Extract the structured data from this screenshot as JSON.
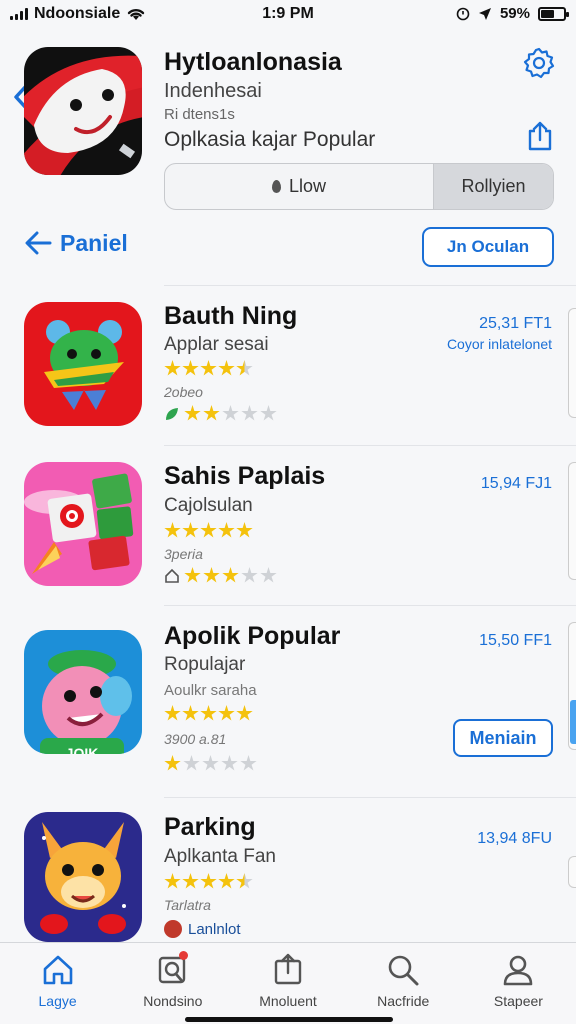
{
  "status_bar": {
    "carrier": "Ndoonsiale",
    "time": "1:9 PM",
    "battery_pct": "59%",
    "battery_level": 0.59,
    "icons": [
      "signal-icon",
      "wifi-icon",
      "alarm-icon",
      "location-icon",
      "battery-icon"
    ]
  },
  "header": {
    "title": "Hytloanlonasia",
    "subtitle": "Indenhesai",
    "meta": "Ri dtens1s",
    "tagline": "Oplkasia kajar Popular",
    "segments": [
      {
        "label": "Llow",
        "active": false
      },
      {
        "label": "Rollyien",
        "active": true
      }
    ]
  },
  "nav": {
    "back_label": "Paniel",
    "action_label": "Jn Oculan"
  },
  "apps": [
    {
      "title": "Bauth Ning",
      "subtitle": "Applar sesai",
      "rating": 4.5,
      "count": "2obeo",
      "secondary_rating": 2,
      "price": "25,31 FT1",
      "developer": "Coyor inlatelonet",
      "button": ""
    },
    {
      "title": "Sahis Paplais",
      "subtitle": "Cajolsulan",
      "rating": 5,
      "count": "3peria",
      "secondary_rating": 3,
      "price": "15,94 FJ1",
      "developer": "",
      "button": ""
    },
    {
      "title": "Apolik Popular",
      "subtitle": "Ropulajar",
      "subtitle2": "Aoulkr saraha",
      "rating": 5,
      "count": "3900 a.81",
      "secondary_rating": 1,
      "price": "15,50 FF1",
      "developer": "",
      "button": "Meniain"
    },
    {
      "title": "Parking",
      "subtitle": "Aplkanta Fan",
      "rating": 4.5,
      "count": "Tarlatra",
      "secondary_label": "Lanlnlot",
      "price": "13,94 8FU",
      "developer": "",
      "button": ""
    }
  ],
  "tab_bar": {
    "tabs": [
      {
        "label": "Lagye",
        "icon": "home-icon",
        "active": true
      },
      {
        "label": "Nondsino",
        "icon": "search-card-icon",
        "active": false,
        "badge": true
      },
      {
        "label": "Mnoluent",
        "icon": "share-card-icon",
        "active": false
      },
      {
        "label": "Nacfride",
        "icon": "search-icon",
        "active": false
      },
      {
        "label": "Stapeer",
        "icon": "profile-icon",
        "active": false
      }
    ]
  },
  "colors": {
    "accent": "#1a6fd6",
    "star": "#f4c20d",
    "background": "#f6f7f9"
  }
}
